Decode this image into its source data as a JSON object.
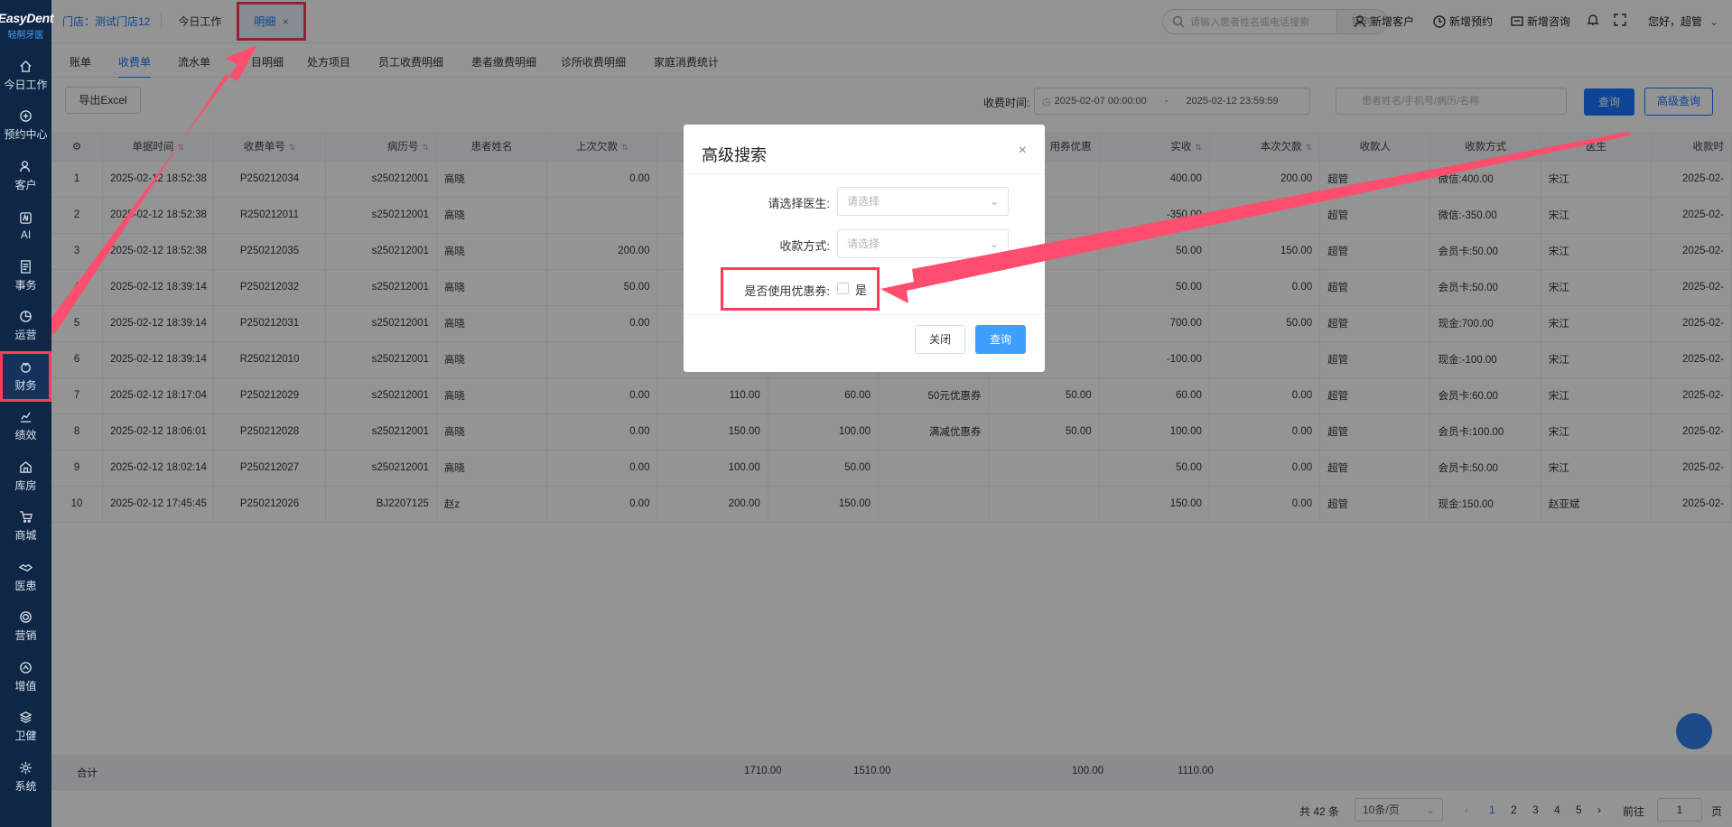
{
  "sidebar": {
    "logo": "EasyDent",
    "logo_sub": "轻舸牙医",
    "items": [
      {
        "label": "今日工作",
        "icon": "home-icon"
      },
      {
        "label": "预约中心",
        "icon": "calendar-icon"
      },
      {
        "label": "客户",
        "icon": "user-icon"
      },
      {
        "label": "AI",
        "icon": "ai-icon"
      },
      {
        "label": "事务",
        "icon": "document-icon"
      },
      {
        "label": "运营",
        "icon": "chart-pie-icon"
      },
      {
        "label": "财务",
        "icon": "finance-icon",
        "active": true
      },
      {
        "label": "绩效",
        "icon": "line-chart-icon"
      },
      {
        "label": "库房",
        "icon": "warehouse-icon"
      },
      {
        "label": "商城",
        "icon": "cart-icon"
      },
      {
        "label": "医患",
        "icon": "handshake-icon"
      },
      {
        "label": "营销",
        "icon": "target-icon"
      },
      {
        "label": "增值",
        "icon": "growth-icon"
      },
      {
        "label": "卫健",
        "icon": "layers-icon"
      },
      {
        "label": "系统",
        "icon": "gear-icon"
      }
    ]
  },
  "topbar": {
    "store": "门店：测试门店12",
    "tabs": [
      {
        "label": "今日工作"
      },
      {
        "label": "明细",
        "close": "×",
        "active": true
      }
    ],
    "search_placeholder": "请输入患者姓名或电话搜索",
    "search_mode": "实时",
    "tools": [
      "新增客户",
      "新增预约",
      "新增咨询"
    ],
    "greeting": "您好，超管"
  },
  "subtabs": [
    "账单",
    "收费单",
    "流水单",
    "目明细",
    "处方项目",
    "员工收费明细",
    "患者缴费明细",
    "诊所收费明细",
    "家庭消费统计"
  ],
  "filters": {
    "export": "导出Excel",
    "time_label": "收费时间:",
    "date_start": "2025-02-07 00:00:00",
    "date_sep": "-",
    "date_end": "2025-02-12 23:59:59",
    "patient_placeholder": "患者姓名/手机号/病历/名称",
    "query": "查询",
    "advanced": "高级查询"
  },
  "table": {
    "headers": [
      "单据时间",
      "收费单号",
      "病历号",
      "患者姓名",
      "上次欠款",
      "",
      "",
      "",
      "用券优惠",
      "实收",
      "本次欠款",
      "收款人",
      "收款方式",
      "医生",
      "收款时"
    ],
    "rows": [
      {
        "n": "1",
        "time": "2025-02-12 18:52:38",
        "no": "P250212034",
        "rec": "s250212001",
        "name": "高晓",
        "prev": "0.00",
        "a": "",
        "b": "",
        "c": "",
        "d": "",
        "paid": "400.00",
        "owe": "200.00",
        "payee": "超管",
        "method": "微信:400.00",
        "doctor": "宋江",
        "pt": "2025-02-"
      },
      {
        "n": "2",
        "time": "2025-02-12 18:52:38",
        "no": "R250212011",
        "rec": "s250212001",
        "name": "高晓",
        "prev": "",
        "a": "",
        "b": "",
        "c": "",
        "d": "",
        "paid": "-350.00",
        "owe": "",
        "payee": "超管",
        "method": "微信:-350.00",
        "doctor": "宋江",
        "pt": "2025-02-"
      },
      {
        "n": "3",
        "time": "2025-02-12 18:52:38",
        "no": "P250212035",
        "rec": "s250212001",
        "name": "高晓",
        "prev": "200.00",
        "a": "",
        "b": "",
        "c": "",
        "d": "",
        "paid": "50.00",
        "owe": "150.00",
        "payee": "超管",
        "method": "会员卡:50.00",
        "doctor": "宋江",
        "pt": "2025-02-"
      },
      {
        "n": "4",
        "time": "2025-02-12 18:39:14",
        "no": "P250212032",
        "rec": "s250212001",
        "name": "高晓",
        "prev": "50.00",
        "a": "",
        "b": "",
        "c": "",
        "d": "",
        "paid": "50.00",
        "owe": "0.00",
        "payee": "超管",
        "method": "会员卡:50.00",
        "doctor": "宋江",
        "pt": "2025-02-"
      },
      {
        "n": "5",
        "time": "2025-02-12 18:39:14",
        "no": "P250212031",
        "rec": "s250212001",
        "name": "高晓",
        "prev": "0.00",
        "a": "",
        "b": "",
        "c": "",
        "d": "",
        "paid": "700.00",
        "owe": "50.00",
        "payee": "超管",
        "method": "现金:700.00",
        "doctor": "宋江",
        "pt": "2025-02-"
      },
      {
        "n": "6",
        "time": "2025-02-12 18:39:14",
        "no": "R250212010",
        "rec": "s250212001",
        "name": "高晓",
        "prev": "",
        "a": "",
        "b": "",
        "c": "",
        "d": "",
        "paid": "-100.00",
        "owe": "",
        "payee": "超管",
        "method": "现金:-100.00",
        "doctor": "宋江",
        "pt": "2025-02-"
      },
      {
        "n": "7",
        "time": "2025-02-12 18:17:04",
        "no": "P250212029",
        "rec": "s250212001",
        "name": "高晓",
        "prev": "0.00",
        "a": "110.00",
        "b": "60.00",
        "c": "50元优惠券",
        "d": "50.00",
        "paid": "60.00",
        "owe": "0.00",
        "payee": "超管",
        "method": "会员卡:60.00",
        "doctor": "宋江",
        "pt": "2025-02-"
      },
      {
        "n": "8",
        "time": "2025-02-12 18:06:01",
        "no": "P250212028",
        "rec": "s250212001",
        "name": "高晓",
        "prev": "0.00",
        "a": "150.00",
        "b": "100.00",
        "c": "满减优惠券",
        "d": "50.00",
        "paid": "100.00",
        "owe": "0.00",
        "payee": "超管",
        "method": "会员卡:100.00",
        "doctor": "宋江",
        "pt": "2025-02-"
      },
      {
        "n": "9",
        "time": "2025-02-12 18:02:14",
        "no": "P250212027",
        "rec": "s250212001",
        "name": "高晓",
        "prev": "0.00",
        "a": "100.00",
        "b": "50.00",
        "c": "",
        "d": "",
        "paid": "50.00",
        "owe": "0.00",
        "payee": "超管",
        "method": "会员卡:50.00",
        "doctor": "宋江",
        "pt": "2025-02-"
      },
      {
        "n": "10",
        "time": "2025-02-12 17:45:45",
        "no": "P250212026",
        "rec": "BJ2207125",
        "name": "赵z",
        "prev": "0.00",
        "a": "200.00",
        "b": "150.00",
        "c": "",
        "d": "",
        "paid": "150.00",
        "owe": "0.00",
        "payee": "超管",
        "method": "现金:150.00",
        "doctor": "赵亚斌",
        "pt": "2025-02-"
      }
    ],
    "total": {
      "label": "合计",
      "a": "1710.00",
      "b": "1510.00",
      "d": "100.00",
      "paid": "1110.00"
    }
  },
  "pager": {
    "total": "共 42 条",
    "size": "10条/页",
    "pages": [
      "1",
      "2",
      "3",
      "4",
      "5"
    ],
    "goto_label": "前往",
    "goto_value": "1",
    "page_unit": "页"
  },
  "modal": {
    "title": "高级搜索",
    "close_icon": "×",
    "doctor_label": "请选择医生:",
    "doctor_placeholder": "请选择",
    "method_label": "收款方式:",
    "method_placeholder": "请选择",
    "coupon_label": "是否使用优惠券:",
    "coupon_option": "是",
    "close_button": "关闭",
    "query_button": "查询"
  },
  "colors": {
    "primary": "#1677ff",
    "sidebar": "#0f2746",
    "highlight": "#ff3b5c"
  }
}
